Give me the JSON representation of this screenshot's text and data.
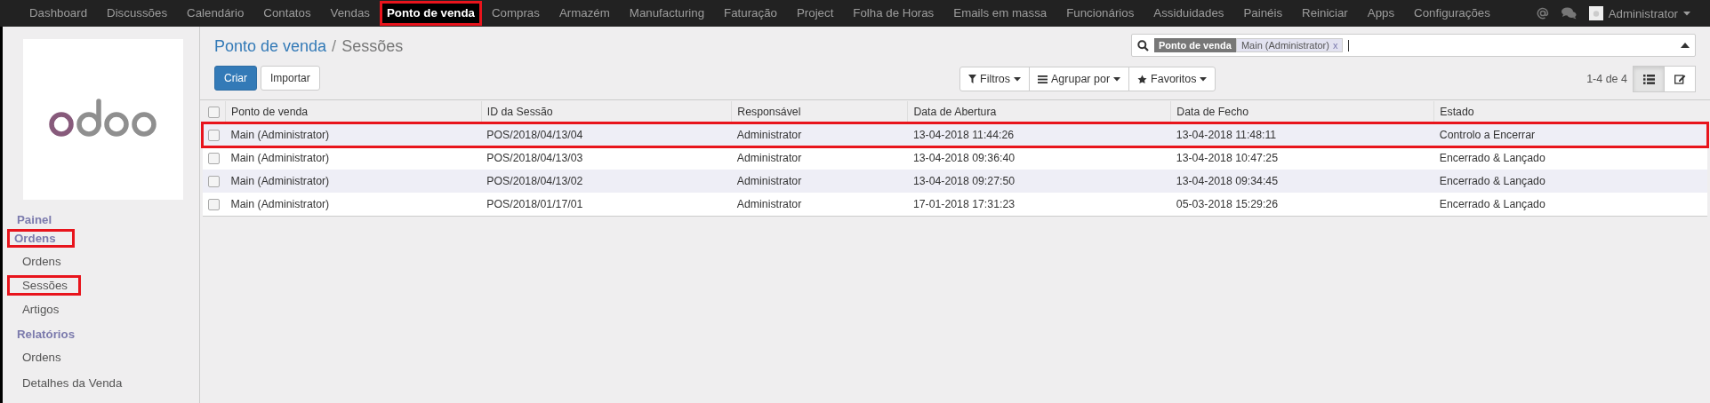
{
  "topbar": {
    "menu": [
      {
        "label": "Dashboard",
        "highlighted": false
      },
      {
        "label": "Discussões",
        "highlighted": false
      },
      {
        "label": "Calendário",
        "highlighted": false
      },
      {
        "label": "Contatos",
        "highlighted": false
      },
      {
        "label": "Vendas",
        "highlighted": false
      },
      {
        "label": "Ponto de venda",
        "highlighted": true
      },
      {
        "label": "Compras",
        "highlighted": false
      },
      {
        "label": "Armazém",
        "highlighted": false
      },
      {
        "label": "Manufacturing",
        "highlighted": false
      },
      {
        "label": "Faturação",
        "highlighted": false
      },
      {
        "label": "Project",
        "highlighted": false
      },
      {
        "label": "Folha de Horas",
        "highlighted": false
      },
      {
        "label": "Emails em massa",
        "highlighted": false
      },
      {
        "label": "Funcionários",
        "highlighted": false
      },
      {
        "label": "Assiduidades",
        "highlighted": false
      },
      {
        "label": "Painéis",
        "highlighted": false
      },
      {
        "label": "Reiniciar",
        "highlighted": false
      },
      {
        "label": "Apps",
        "highlighted": false
      },
      {
        "label": "Configurações",
        "highlighted": false
      }
    ],
    "user": "Administrator"
  },
  "sidebar": {
    "sections": [
      {
        "title": "Painel",
        "highlighted": false
      },
      {
        "title": "Ordens",
        "highlighted": true,
        "items": [
          {
            "label": "Ordens",
            "highlighted": false
          },
          {
            "label": "Sessões",
            "highlighted": true
          },
          {
            "label": "Artigos",
            "highlighted": false
          }
        ]
      },
      {
        "title": "Relatórios",
        "highlighted": false,
        "items": [
          {
            "label": "Ordens",
            "highlighted": false
          },
          {
            "label": "Detalhes da Venda",
            "highlighted": false
          }
        ]
      }
    ]
  },
  "breadcrumb": {
    "parent": "Ponto de venda",
    "separator": "/",
    "current": "Sessões"
  },
  "buttons": [
    {
      "kind": "primary",
      "label": "Criar"
    },
    {
      "kind": "default",
      "label": "Importar"
    }
  ],
  "search": {
    "facet_category": "Ponto de venda",
    "facet_value": "Main (Administrator)",
    "facet_remove": "x"
  },
  "search_options": [
    {
      "kind": "filter",
      "label": "Filtros"
    },
    {
      "kind": "group",
      "label": "Agrupar por"
    },
    {
      "kind": "favorite",
      "label": "Favoritos"
    }
  ],
  "pager": "1-4 de 4",
  "views": [
    {
      "kind": "list",
      "selected": true
    },
    {
      "kind": "form",
      "selected": false
    }
  ],
  "table": {
    "all_checked": false,
    "columns": [
      "Ponto de venda",
      "ID da Sessão",
      "Responsável",
      "Data de Abertura",
      "Data de Fecho",
      "Estado"
    ],
    "rows": [
      {
        "checked": false,
        "highlighted": true,
        "cells": [
          "Main (Administrator)",
          "POS/2018/04/13/04",
          "Administrator",
          "13-04-2018 11:44:26",
          "13-04-2018 11:48:11",
          "Controlo a Encerrar"
        ]
      },
      {
        "checked": false,
        "highlighted": false,
        "cells": [
          "Main (Administrator)",
          "POS/2018/04/13/03",
          "Administrator",
          "13-04-2018 09:36:40",
          "13-04-2018 10:47:25",
          "Encerrado & Lançado"
        ]
      },
      {
        "checked": false,
        "highlighted": false,
        "cells": [
          "Main (Administrator)",
          "POS/2018/04/13/02",
          "Administrator",
          "13-04-2018 09:27:50",
          "13-04-2018 09:34:45",
          "Encerrado & Lançado"
        ]
      },
      {
        "checked": false,
        "highlighted": false,
        "cells": [
          "Main (Administrator)",
          "POS/2018/01/17/01",
          "Administrator",
          "17-01-2018 17:31:23",
          "05-03-2018 15:29:26",
          "Encerrado & Lançado"
        ]
      }
    ]
  }
}
